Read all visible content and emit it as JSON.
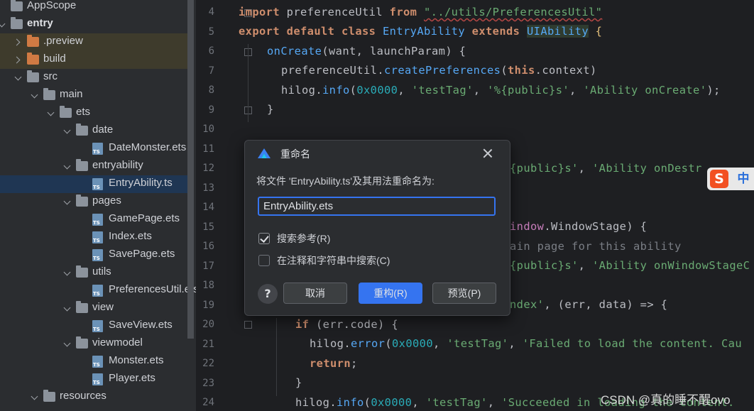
{
  "project_tree": {
    "items": [
      {
        "label": "AppScope",
        "type": "folder"
      },
      {
        "label": "entry",
        "type": "module"
      },
      {
        "label": ".preview",
        "type": "folder-excluded"
      },
      {
        "label": "build",
        "type": "folder-excluded"
      },
      {
        "label": "src",
        "type": "folder"
      },
      {
        "label": "main",
        "type": "folder"
      },
      {
        "label": "ets",
        "type": "folder"
      },
      {
        "label": "date",
        "type": "folder"
      },
      {
        "label": "DateMonster.ets",
        "type": "file"
      },
      {
        "label": "entryability",
        "type": "folder"
      },
      {
        "label": "EntryAbility.ts",
        "type": "file",
        "selected": true
      },
      {
        "label": "pages",
        "type": "folder"
      },
      {
        "label": "GamePage.ets",
        "type": "file"
      },
      {
        "label": "Index.ets",
        "type": "file"
      },
      {
        "label": "SavePage.ets",
        "type": "file"
      },
      {
        "label": "utils",
        "type": "folder"
      },
      {
        "label": "PreferencesUtil.ets",
        "type": "file"
      },
      {
        "label": "view",
        "type": "folder"
      },
      {
        "label": "SaveView.ets",
        "type": "file"
      },
      {
        "label": "viewmodel",
        "type": "folder"
      },
      {
        "label": "Monster.ets",
        "type": "file"
      },
      {
        "label": "Player.ets",
        "type": "file"
      },
      {
        "label": "resources",
        "type": "folder"
      }
    ]
  },
  "editor": {
    "line_numbers": [
      "4",
      "5",
      "6",
      "7",
      "8",
      "9",
      "10",
      "11",
      "12",
      "13",
      "14",
      "15",
      "16",
      "17",
      "18",
      "19",
      "20",
      "21",
      "22",
      "23",
      "24"
    ],
    "lines": {
      "l4_import": "import",
      "l4_name": " preferenceUtil ",
      "l4_from": "from",
      "l4_path": "\"../utils/PreferencesUtil\"",
      "l5_export": "export default class",
      "l5_cls": " EntryAbility ",
      "l5_extends": "extends",
      "l5_base": "UIAbility",
      "l5_brace": " {",
      "l6_fn": "onCreate",
      "l6_args": "(want, launchParam) {",
      "l7_obj": "preferenceUtil.",
      "l7_fn": "createPreferences",
      "l7_open": "(",
      "l7_this": "this",
      "l7_rest": ".context)",
      "l8_obj": "hilog.",
      "l8_fn": "info",
      "l8_open": "(",
      "l8_num": "0x0000",
      "l8_sep1": ", ",
      "l8_tag": "'testTag'",
      "l8_sep2": ", ",
      "l8_fmt": "'%{public}s'",
      "l8_sep3": ", ",
      "l8_msg": "'Ability onCreate'",
      "l8_end": ");",
      "l9": "}",
      "l12_str": "{public}s'",
      "l12_sep": ", ",
      "l12_msg": "'Ability onDestr",
      "l15_prop": "indow",
      "l15_rest": ".WindowStage) {",
      "l16_cm": "ain page for this ability",
      "l17_str": "{public}s'",
      "l17_sep": ", ",
      "l17_msg": "'Ability onWindowStageC",
      "l19_str": "ndex'",
      "l19_rest": ", (err, data) => {",
      "l20_if": "if",
      "l20_rest": " (err.code) {",
      "l21_obj": "hilog.",
      "l21_fn": "error",
      "l21_open": "(",
      "l21_num": "0x0000",
      "l21_sep1": ", ",
      "l21_tag": "'testTag'",
      "l21_sep2": ", ",
      "l21_msg": "'Failed to load the content. Cau",
      "l22_return": "return",
      "l22_semi": ";",
      "l23": "}",
      "l24_obj": "hilog.",
      "l24_fn": "info",
      "l24_open": "(",
      "l24_num": "0x0000",
      "l24_sep1": ", ",
      "l24_tag": "'testTag'",
      "l24_sep2": ", ",
      "l24_msg": "'Succeeded in loading the content."
    }
  },
  "dialog": {
    "title": "重命名",
    "prompt": "将文件 'EntryAbility.ts'及其用法重命名为:",
    "input_value": "EntryAbility.ets",
    "checkbox_search_refs": {
      "label": "搜索参考(R)",
      "checked": true
    },
    "checkbox_search_comments": {
      "label": "在注释和字符串中搜索(C)",
      "checked": false
    },
    "help_label": "?",
    "cancel_label": "取消",
    "refactor_label": "重构(R)",
    "preview_label": "预览(P)"
  },
  "ime": {
    "logo": "S",
    "mode": "中"
  },
  "watermark": "CSDN @真的睡不醒ovo",
  "colors": {
    "accent": "#3574f0",
    "keyword": "#cf8e6d",
    "string": "#6aab73",
    "function": "#56a8f5",
    "number": "#2aacb8"
  }
}
